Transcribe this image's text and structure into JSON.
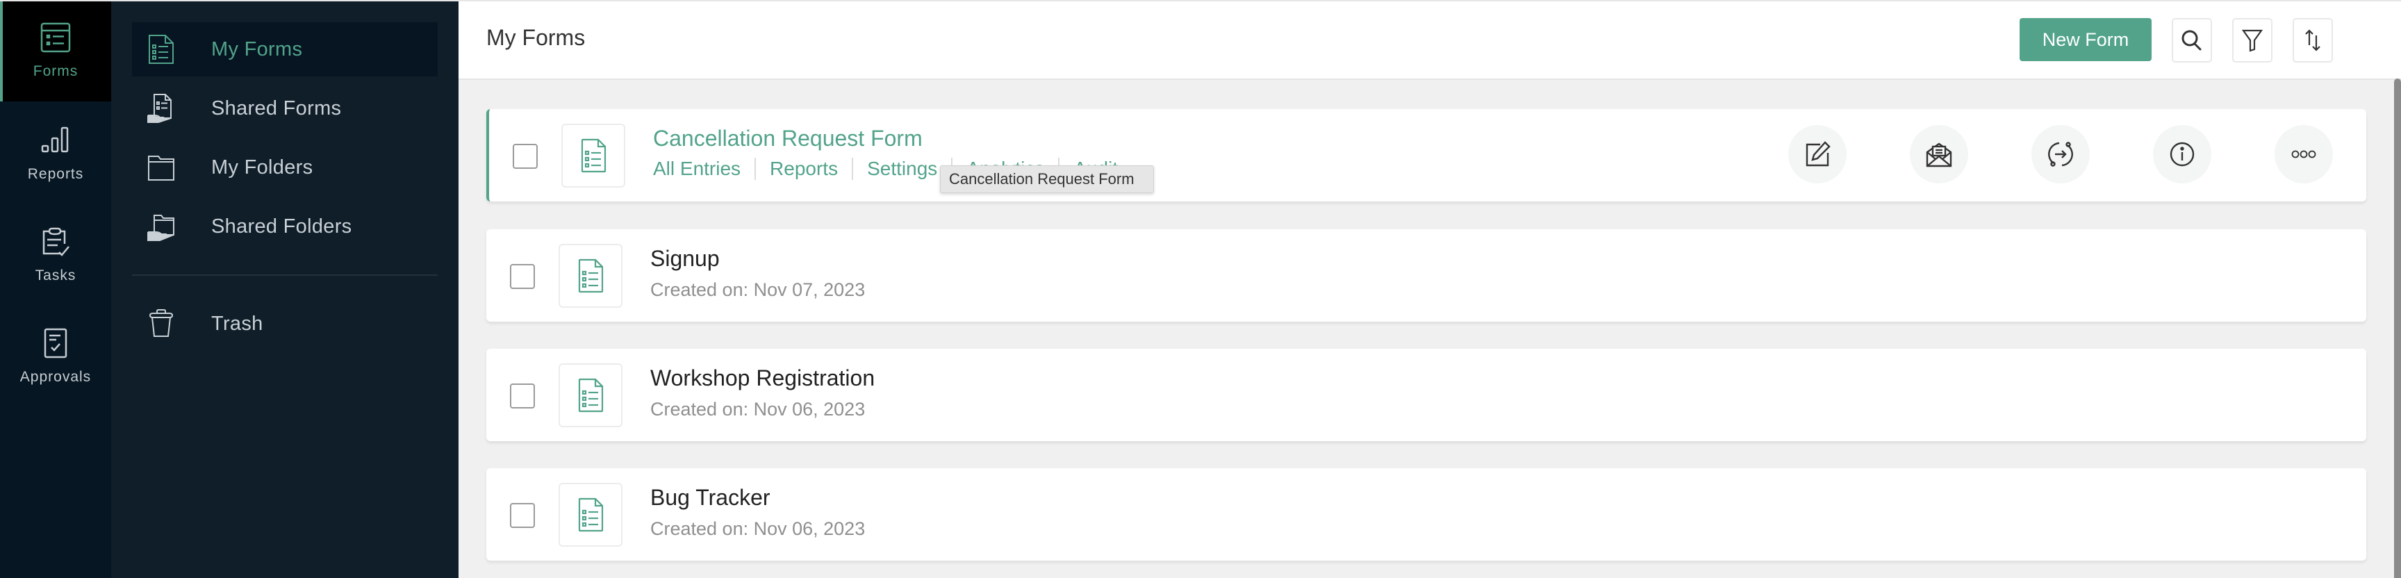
{
  "rail": {
    "items": [
      {
        "label": "Forms",
        "icon": "forms-icon",
        "active": true
      },
      {
        "label": "Reports",
        "icon": "bar-chart-icon",
        "active": false
      },
      {
        "label": "Tasks",
        "icon": "clipboard-check-icon",
        "active": false
      },
      {
        "label": "Approvals",
        "icon": "approval-doc-icon",
        "active": false
      }
    ]
  },
  "subnav": {
    "items": [
      {
        "label": "My Forms",
        "icon": "form-document-icon",
        "active": true
      },
      {
        "label": "Shared Forms",
        "icon": "shared-form-icon",
        "active": false
      },
      {
        "label": "My Folders",
        "icon": "folder-icon",
        "active": false
      },
      {
        "label": "Shared Folders",
        "icon": "shared-folder-icon",
        "active": false
      }
    ],
    "trash_label": "Trash"
  },
  "header": {
    "title": "My Forms",
    "new_form_label": "New Form",
    "icons": [
      "search-icon",
      "filter-icon",
      "sort-icon"
    ]
  },
  "forms": [
    {
      "name": "Cancellation Request Form",
      "active": true,
      "links": [
        "All Entries",
        "Reports",
        "Settings",
        "Analytics",
        "Audit"
      ],
      "actions": [
        "edit-icon",
        "share-envelope-icon",
        "integrate-icon",
        "info-icon",
        "more-icon"
      ]
    },
    {
      "name": "Signup",
      "created": "Created on: Nov 07, 2023"
    },
    {
      "name": "Workshop Registration",
      "created": "Created on: Nov 06, 2023"
    },
    {
      "name": "Bug Tracker",
      "created": "Created on: Nov 06, 2023"
    }
  ],
  "tooltip": "Cancellation Request Form",
  "colors": {
    "accent": "#52a38a",
    "rail_bg": "#061622",
    "subnav_bg": "#0f1e29",
    "content_bg": "#f0f0f0"
  }
}
